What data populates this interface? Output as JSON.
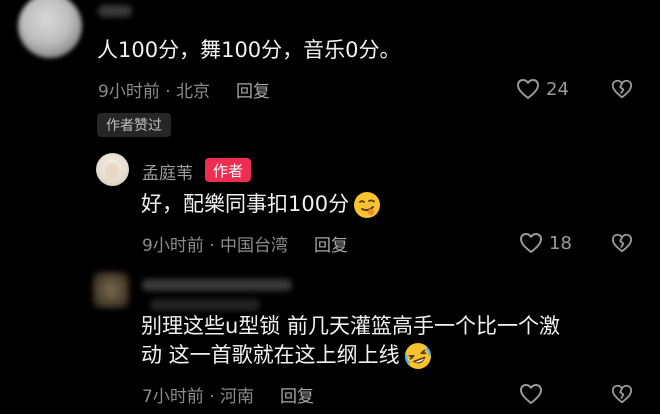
{
  "comments": [
    {
      "text": "人100分，舞100分，音乐0分。",
      "time_location": "9小时前 · 北京",
      "reply_label": "回复",
      "likes": "24",
      "badge": "作者赞过"
    },
    {
      "username": "孟庭苇",
      "author_tag": "作者",
      "text": "好，配樂同事扣100分",
      "time_location": "9小时前 · 中国台湾",
      "reply_label": "回复",
      "likes": "18"
    },
    {
      "text_line1": "别理这些u型锁 前几天灌篮高手一个比一个激",
      "text_line2": "动 这一首歌就在这上纲上线",
      "time_location": "7小时前 · 河南",
      "reply_label": "回复"
    }
  ],
  "colors": {
    "background": "#000000",
    "author_tag": "#ef2d51",
    "text": "#f2f2f2",
    "meta": "#8c8c8c"
  },
  "icons": {
    "like": "heart-outline-icon",
    "dislike": "broken-heart-icon",
    "emoji_1": "smirk-emoji-icon",
    "emoji_2": "rofl-emoji-icon"
  }
}
